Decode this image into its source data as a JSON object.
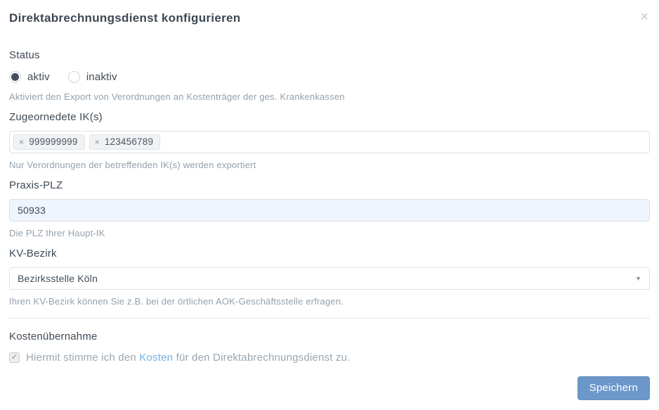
{
  "dialog": {
    "title": "Direktabrechnungsdienst konfigurieren",
    "close_icon": "×"
  },
  "status": {
    "label": "Status",
    "options": [
      {
        "label": "aktiv",
        "selected": true
      },
      {
        "label": "inaktiv",
        "selected": false
      }
    ],
    "help": "Aktiviert den Export von Verordnungen an Kostenträger der ges. Krankenkassen"
  },
  "iks": {
    "label": "Zugeornedete IK(s)",
    "remove_icon": "×",
    "tags": [
      "999999999",
      "123456789"
    ],
    "help": "Nur Verordnungen der betreffenden IK(s) werden exportiert"
  },
  "plz": {
    "label": "Praxis-PLZ",
    "value": "50933",
    "help": "Die PLZ Ihrer Haupt-IK"
  },
  "kv": {
    "label": "KV-Bezirk",
    "selected_option": "Bezirksstelle Köln",
    "arrow_icon": "▼",
    "help": "Ihren KV-Bezirk können Sie z.B. bei der örtlichen AOK-Geschäftsstelle erfragen."
  },
  "consent": {
    "label": "Kostenübernahme",
    "checked": true,
    "check_icon": "✓",
    "text_before": "Hiermit stimme ich den ",
    "link_text": "Kosten",
    "text_after": " für den Direktabrechnungsdienst zu."
  },
  "footer": {
    "save_label": "Speichern"
  },
  "colors": {
    "accent_blue": "#6b97c9",
    "link_blue": "#77b1e2",
    "label_dark": "#3f4a56",
    "help_gray": "#93a0ac",
    "plz_input_bg": "#eff5fc"
  }
}
